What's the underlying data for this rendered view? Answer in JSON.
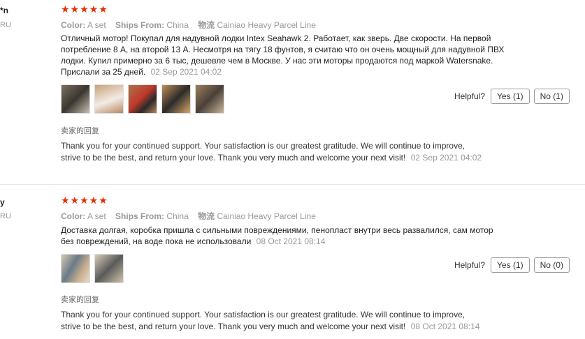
{
  "reviews": [
    {
      "user": "*n",
      "country": "RU",
      "stars": "★★★★★",
      "color_key": "Color:",
      "color_val": "A set",
      "ships_key": "Ships From:",
      "ships_val": "China",
      "logistics_key": "物流",
      "logistics_val": "Cainiao Heavy Parcel Line",
      "text": "Отличный мотор! Покупал для надувной лодки Intex Seahawk 2. Работает, как зверь. Две скорости. На первой потребление 8 А, на второй 13 А. Несмотря на тягу 18 фунтов, я считаю что он очень мощный для надувной ПВХ лодки. Купил примерно за 6 тыс, дешевле чем в Москве. У нас эти моторы продаются под маркой Watersnake. Прислали за 25 дней.",
      "date": "02 Sep 2021 04:02",
      "photos": [
        "photo-1",
        "photo-2",
        "photo-3",
        "photo-4",
        "photo-5"
      ],
      "helpful_label": "Helpful?",
      "yes_label": "Yes (1)",
      "no_label": "No (1)",
      "seller_title": "卖家的回复",
      "seller_text": "Thank you for your continued support. Your satisfaction is our greatest gratitude. We will continue to improve, strive to be the best, and return your love. Thank you very much and welcome your next visit!",
      "seller_date": "02 Sep 2021 04:02"
    },
    {
      "user": "y",
      "country": "RU",
      "stars": "★★★★★",
      "color_key": "Color:",
      "color_val": "A set",
      "ships_key": "Ships From:",
      "ships_val": "China",
      "logistics_key": "物流",
      "logistics_val": "Cainiao Heavy Parcel Line",
      "text": "Доставка долгая, коробка пришла с сильными повреждениями, пенопласт внутри весь развалился, сам мотор без повреждений, на воде пока не использовали",
      "date": "08 Oct 2021 08:14",
      "photos": [
        "photo-1",
        "photo-2"
      ],
      "helpful_label": "Helpful?",
      "yes_label": "Yes (1)",
      "no_label": "No (0)",
      "seller_title": "卖家的回复",
      "seller_text": "Thank you for your continued support. Your satisfaction is our greatest gratitude. We will continue to improve, strive to be the best, and return your love. Thank you very much and welcome your next visit!",
      "seller_date": "08 Oct 2021 08:14"
    }
  ],
  "colors": {
    "star": "#e62e04",
    "muted": "#999999"
  }
}
